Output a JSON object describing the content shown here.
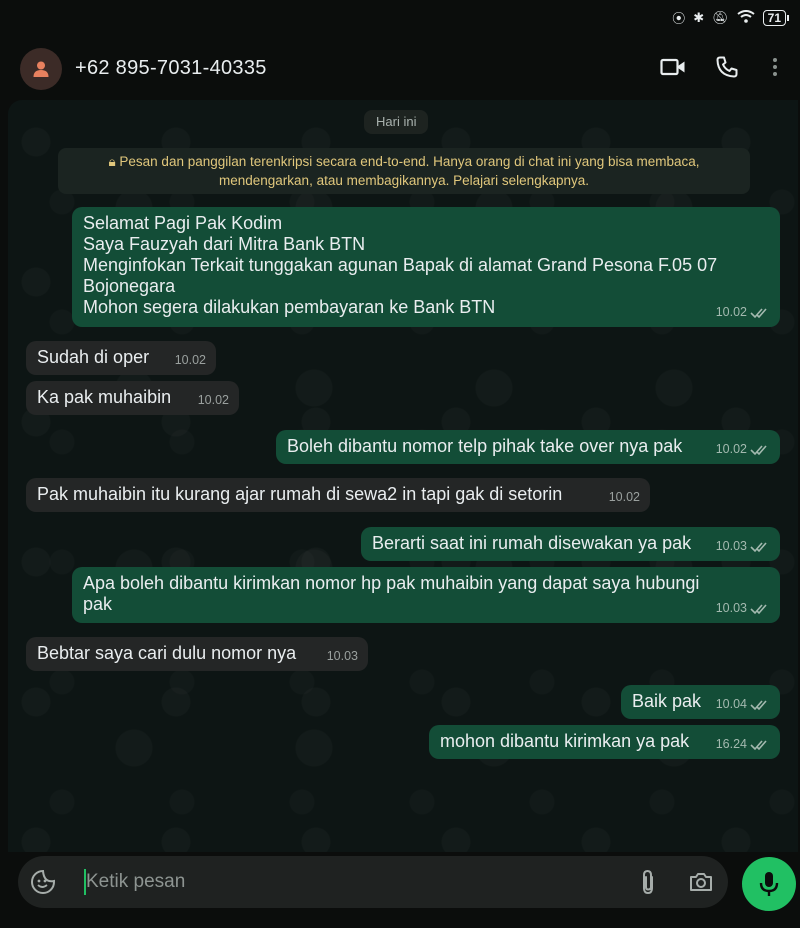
{
  "status": {
    "battery": "71"
  },
  "header": {
    "contact": "+62 895-7031-40335"
  },
  "date_chip": "Hari ini",
  "encryption_notice": "Pesan dan panggilan terenkripsi secara end-to-end. Hanya orang di chat ini yang bisa membaca,\nmendengarkan, atau membagikannya. Pelajari selengkapnya.",
  "messages": [
    {
      "dir": "out",
      "text": "Selamat Pagi Pak Kodim\nSaya Fauzyah dari Mitra Bank BTN\nMenginfokan Terkait tunggakan agunan Bapak di alamat Grand Pesona F.05 07\nBojonegara\nMohon segera dilakukan pembayaran ke Bank BTN",
      "time": "10.02"
    },
    {
      "dir": "in",
      "text": "Sudah di oper",
      "time": "10.02"
    },
    {
      "dir": "in",
      "text": "Ka pak muhaibin",
      "time": "10.02"
    },
    {
      "dir": "out",
      "text": "Boleh dibantu nomor telp pihak take over nya pak",
      "time": "10.02"
    },
    {
      "dir": "in",
      "text": "Pak muhaibin itu kurang ajar rumah di sewa2 in tapi gak di setorin",
      "time": "10.02"
    },
    {
      "dir": "out",
      "text": "Berarti saat ini rumah disewakan ya pak",
      "time": "10.03"
    },
    {
      "dir": "out",
      "text": "Apa boleh dibantu kirimkan nomor hp pak muhaibin yang dapat saya hubungi\npak",
      "time": "10.03"
    },
    {
      "dir": "in",
      "text": "Bebtar saya cari dulu nomor nya",
      "time": "10.03"
    },
    {
      "dir": "out",
      "text": "Baik pak",
      "time": "10.04"
    },
    {
      "dir": "out",
      "text": "mohon dibantu kirimkan ya pak",
      "time": "16.24"
    }
  ],
  "input": {
    "placeholder": "Ketik pesan"
  },
  "colors": {
    "accent": "#21c063",
    "outgoing": "#134d37",
    "incoming": "#242626"
  }
}
